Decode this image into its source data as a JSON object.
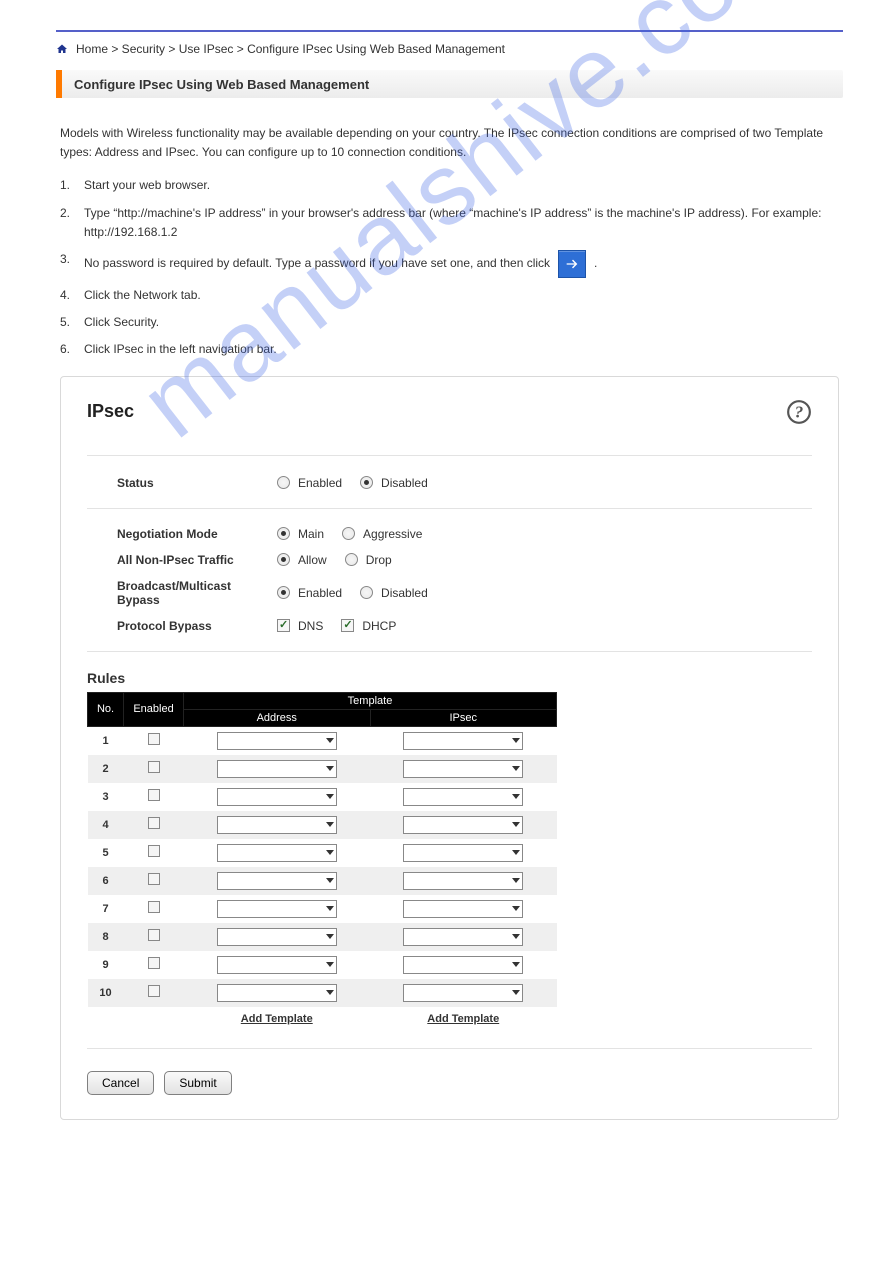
{
  "watermark": "manualshive.com",
  "breadcrumb_home": "Home > Security > Use IPsec > Configure IPsec Using Web Based Management",
  "section_title": "Configure IPsec Using Web Based Management",
  "intro": "Models with Wireless functionality may be available depending on your country. The IPsec connection conditions are comprised of two Template types: Address and IPsec. You can configure up to 10 connection conditions.",
  "steps": [
    "Start your web browser.",
    "Type “http://machine's IP address” in your browser's address bar (where “machine's IP address” is the machine's IP address). For example: http://192.168.1.2",
    "No password is required by default. Type a password if you have set one, and then click",
    "Click the Network tab.",
    "Click Security.",
    "Click IPsec in the left navigation bar."
  ],
  "ipsec": {
    "title": "IPsec",
    "status_label": "Status",
    "status_options": [
      "Enabled",
      "Disabled"
    ],
    "status_selected": 1,
    "neg_label": "Negotiation Mode",
    "neg_options": [
      "Main",
      "Aggressive"
    ],
    "neg_selected": 0,
    "traffic_label": "All Non-IPsec Traffic",
    "traffic_options": [
      "Allow",
      "Drop"
    ],
    "traffic_selected": 0,
    "bypass_label": "Broadcast/Multicast Bypass",
    "bypass_options": [
      "Enabled",
      "Disabled"
    ],
    "bypass_selected": 0,
    "proto_label": "Protocol Bypass",
    "proto_options": [
      "DNS",
      "DHCP"
    ],
    "proto_checked": [
      true,
      true
    ],
    "rules_title": "Rules",
    "thead_no": "No.",
    "thead_enabled": "Enabled",
    "thead_template": "Template",
    "thead_addr": "Address",
    "thead_ipsec": "IPsec",
    "rows": [
      "1",
      "2",
      "3",
      "4",
      "5",
      "6",
      "7",
      "8",
      "9",
      "10"
    ],
    "add_template": "Add Template",
    "cancel": "Cancel",
    "submit": "Submit"
  }
}
